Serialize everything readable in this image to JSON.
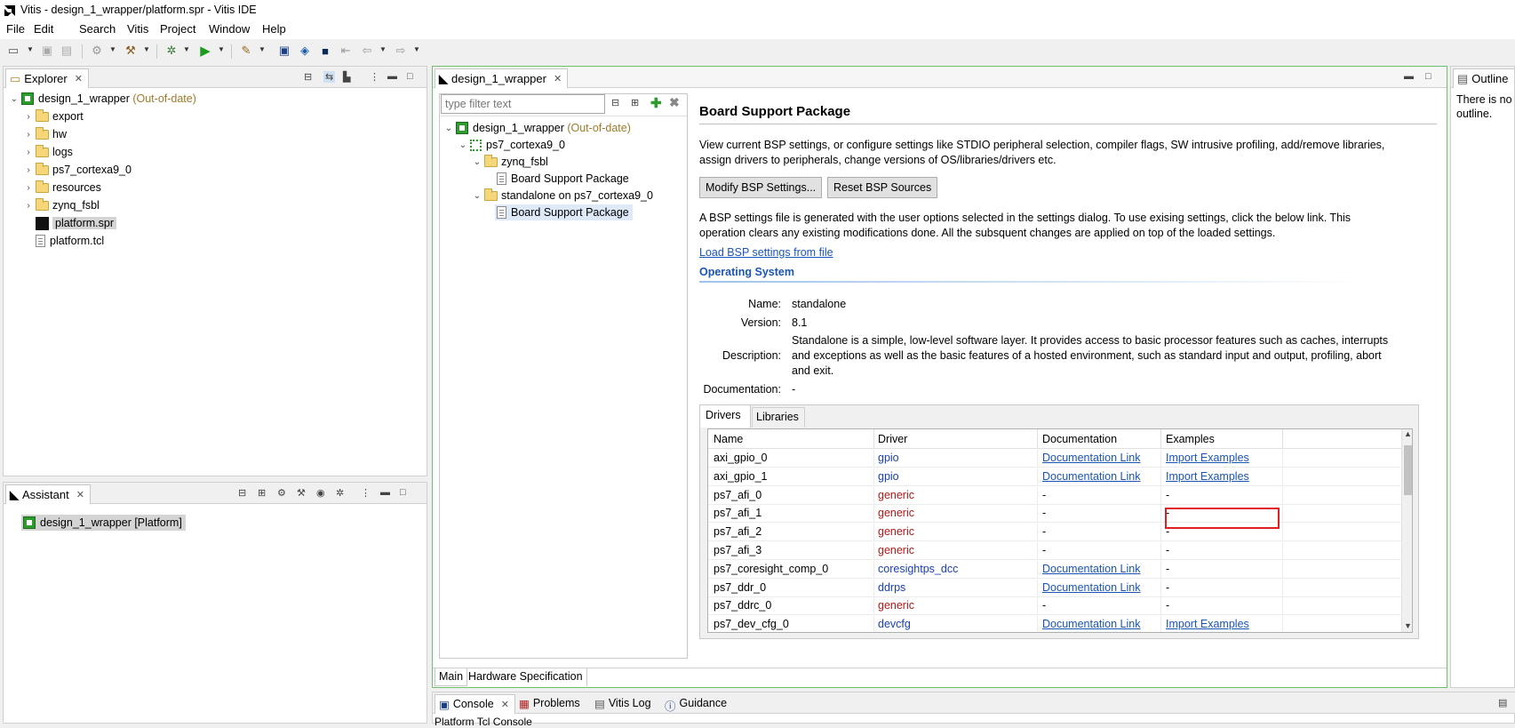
{
  "window": {
    "title": "Vitis - design_1_wrapper/platform.spr - Vitis IDE"
  },
  "menu": [
    "File",
    "Edit",
    "Search",
    "Vitis",
    "Project",
    "Window",
    "Help"
  ],
  "explorer": {
    "tab_label": "Explorer",
    "root": {
      "label": "design_1_wrapper",
      "status": "(Out-of-date)"
    },
    "items": [
      {
        "label": "export",
        "type": "folder"
      },
      {
        "label": "hw",
        "type": "folder"
      },
      {
        "label": "logs",
        "type": "folder"
      },
      {
        "label": "ps7_cortexa9_0",
        "type": "folder"
      },
      {
        "label": "resources",
        "type": "folder"
      },
      {
        "label": "zynq_fsbl",
        "type": "folder"
      },
      {
        "label": "platform.spr",
        "type": "spr"
      },
      {
        "label": "platform.tcl",
        "type": "file"
      }
    ]
  },
  "assistant": {
    "tab_label": "Assistant",
    "item": "design_1_wrapper [Platform]"
  },
  "editor": {
    "tab_label": "design_1_wrapper",
    "filter_placeholder": "type filter text",
    "tree": {
      "root": {
        "label": "design_1_wrapper",
        "status": "(Out-of-date)"
      },
      "cpu": "ps7_cortexa9_0",
      "fsbl": "zynq_fsbl",
      "fsbl_bsp": "Board Support Package",
      "standalone": "standalone on ps7_cortexa9_0",
      "standalone_bsp": "Board Support Package"
    },
    "bottom_tabs": [
      "Main",
      "Hardware Specification"
    ]
  },
  "bsp": {
    "heading": "Board Support Package",
    "intro_line1": "View current BSP settings, or configure settings like STDIO peripheral selection, compiler flags, SW intrusive profiling, add/remove libraries,",
    "intro_line2": "assign drivers to peripherals, change versions of OS/libraries/drivers etc.",
    "modify_button": "Modify BSP Settings...",
    "reset_button": "Reset BSP Sources",
    "note_line1": "A BSP settings file is generated with the user options selected in the settings dialog. To use exising settings, click the below link. This",
    "note_line2": "operation clears any existing modifications done. All the subsquent changes are applied on top of the loaded settings.",
    "load_link": "Load BSP settings from file",
    "os_section": "Operating System",
    "os": {
      "name_label": "Name:",
      "name": "standalone",
      "version_label": "Version:",
      "version": "8.1",
      "description_label": "Description:",
      "description_line1": "Standalone is a simple, low-level software layer. It provides access to basic processor features such as caches, interrupts",
      "description_line2": "and exceptions as well as the basic features of a hosted environment, such as standard input and output, profiling, abort",
      "description_line3": "and exit.",
      "documentation_label": "Documentation:",
      "documentation": "-"
    },
    "tabs": [
      "Drivers",
      "Libraries"
    ],
    "drivers_table": {
      "columns": [
        "Name",
        "Driver",
        "Documentation",
        "Examples"
      ],
      "rows": [
        {
          "name": "axi_gpio_0",
          "driver": "gpio",
          "doc": "Documentation Link",
          "examples": "Import Examples"
        },
        {
          "name": "axi_gpio_1",
          "driver": "gpio",
          "doc": "Documentation Link",
          "examples": "Import Examples"
        },
        {
          "name": "ps7_afi_0",
          "driver": "generic",
          "doc": "-",
          "examples": "-"
        },
        {
          "name": "ps7_afi_1",
          "driver": "generic",
          "doc": "-",
          "examples": "-"
        },
        {
          "name": "ps7_afi_2",
          "driver": "generic",
          "doc": "-",
          "examples": "-"
        },
        {
          "name": "ps7_afi_3",
          "driver": "generic",
          "doc": "-",
          "examples": "-"
        },
        {
          "name": "ps7_coresight_comp_0",
          "driver": "coresightps_dcc",
          "doc": "Documentation Link",
          "examples": "-"
        },
        {
          "name": "ps7_ddr_0",
          "driver": "ddrps",
          "doc": "Documentation Link",
          "examples": "-"
        },
        {
          "name": "ps7_ddrc_0",
          "driver": "generic",
          "doc": "-",
          "examples": "-"
        },
        {
          "name": "ps7_dev_cfg_0",
          "driver": "devcfg",
          "doc": "Documentation Link",
          "examples": "Import Examples"
        }
      ]
    }
  },
  "outline": {
    "tab_label": "Outline",
    "text_line1": "There is no",
    "text_line2": "outline."
  },
  "console": {
    "tabs": [
      "Console",
      "Problems",
      "Vitis Log",
      "Guidance"
    ],
    "subtitle": "Platform Tcl Console"
  }
}
